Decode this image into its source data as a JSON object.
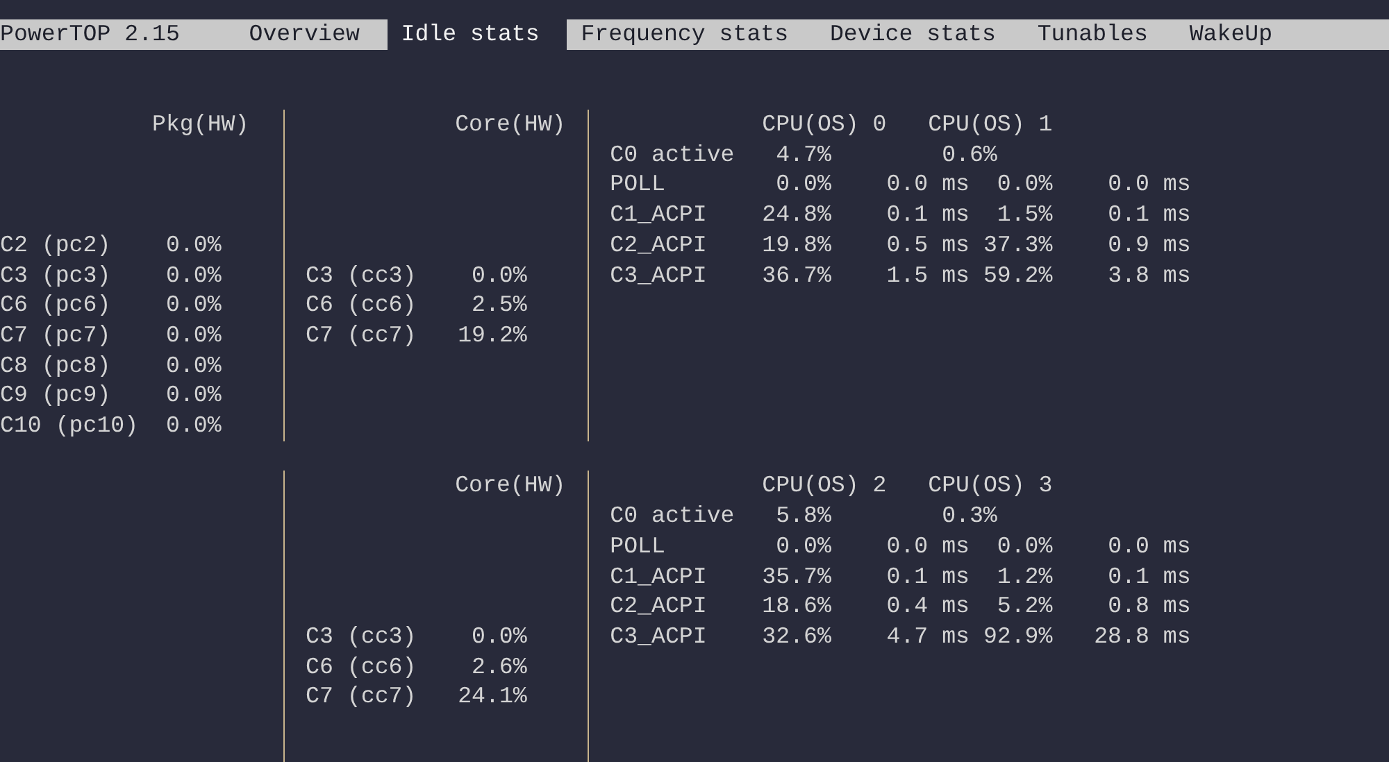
{
  "app": {
    "title": "PowerTOP 2.15"
  },
  "tabs": [
    {
      "label": "Overview",
      "selected": false
    },
    {
      "label": "Idle stats",
      "selected": true
    },
    {
      "label": "Frequency stats",
      "selected": false
    },
    {
      "label": "Device stats",
      "selected": false
    },
    {
      "label": "Tunables",
      "selected": false
    },
    {
      "label": "WakeUp",
      "selected": false
    }
  ],
  "sections": [
    {
      "package": {
        "header": "Pkg(HW)",
        "states": [
          {
            "name": "C2 (pc2)",
            "value": "0.0%"
          },
          {
            "name": "C3 (pc3)",
            "value": "0.0%"
          },
          {
            "name": "C6 (pc6)",
            "value": "0.0%"
          },
          {
            "name": "C7 (pc7)",
            "value": "0.0%"
          },
          {
            "name": "C8 (pc8)",
            "value": "0.0%"
          },
          {
            "name": "C9 (pc9)",
            "value": "0.0%"
          },
          {
            "name": "C10 (pc10)",
            "value": "0.0%"
          }
        ]
      },
      "core": {
        "header": "Core(HW)",
        "states": [
          {
            "name": "C3 (cc3)",
            "value": "0.0%"
          },
          {
            "name": "C6 (cc6)",
            "value": "2.5%"
          },
          {
            "name": "C7 (cc7)",
            "value": "19.2%"
          }
        ]
      },
      "cpus": {
        "headers": [
          "CPU(OS) 0",
          "CPU(OS) 1"
        ],
        "rows": [
          {
            "kind": "active",
            "name": "C0 active",
            "values": [
              "4.7%",
              "0.6%"
            ]
          },
          {
            "kind": "state",
            "name": "POLL",
            "values": [
              "0.0%",
              "0.0 ms",
              "0.0%",
              "0.0 ms"
            ]
          },
          {
            "kind": "state",
            "name": "C1_ACPI",
            "values": [
              "24.8%",
              "0.1 ms",
              "1.5%",
              "0.1 ms"
            ]
          },
          {
            "kind": "state",
            "name": "C2_ACPI",
            "values": [
              "19.8%",
              "0.5 ms",
              "37.3%",
              "0.9 ms"
            ]
          },
          {
            "kind": "state",
            "name": "C3_ACPI",
            "values": [
              "36.7%",
              "1.5 ms",
              "59.2%",
              "3.8 ms"
            ]
          }
        ]
      }
    },
    {
      "core": {
        "header": "Core(HW)",
        "states": [
          {
            "name": "C3 (cc3)",
            "value": "0.0%"
          },
          {
            "name": "C6 (cc6)",
            "value": "2.6%"
          },
          {
            "name": "C7 (cc7)",
            "value": "24.1%"
          }
        ]
      },
      "cpus": {
        "headers": [
          "CPU(OS) 2",
          "CPU(OS) 3"
        ],
        "rows": [
          {
            "kind": "active",
            "name": "C0 active",
            "values": [
              "5.8%",
              "0.3%"
            ]
          },
          {
            "kind": "state",
            "name": "POLL",
            "values": [
              "0.0%",
              "0.0 ms",
              "0.0%",
              "0.0 ms"
            ]
          },
          {
            "kind": "state",
            "name": "C1_ACPI",
            "values": [
              "35.7%",
              "0.1 ms",
              "1.2%",
              "0.1 ms"
            ]
          },
          {
            "kind": "state",
            "name": "C2_ACPI",
            "values": [
              "18.6%",
              "0.4 ms",
              "5.2%",
              "0.8 ms"
            ]
          },
          {
            "kind": "state",
            "name": "C3_ACPI",
            "values": [
              "32.6%",
              "4.7 ms",
              "92.9%",
              "28.8 ms"
            ]
          }
        ]
      }
    }
  ]
}
